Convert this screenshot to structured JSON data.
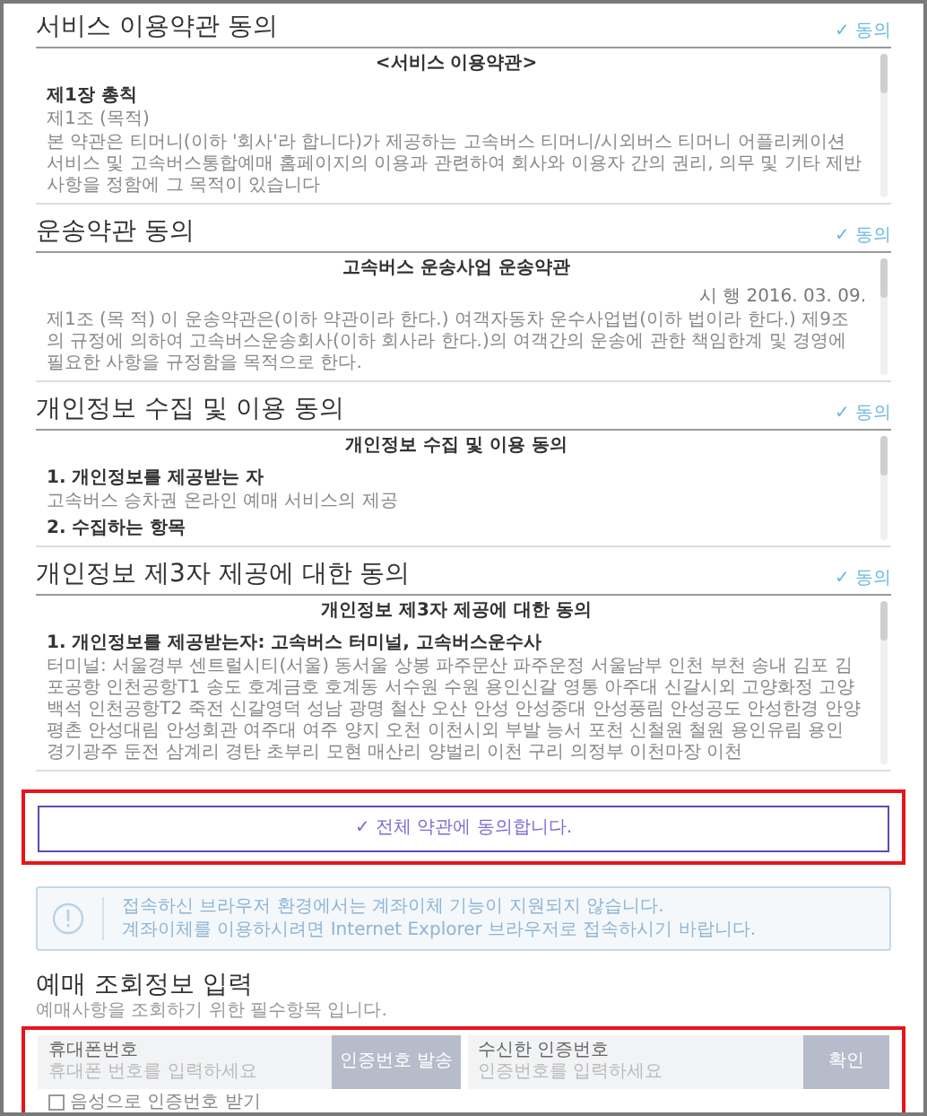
{
  "sections": [
    {
      "title": "서비스 이용약관 동의",
      "agree": "✓ 동의",
      "content": [
        {
          "kind": "heading",
          "text": "<서비스 이용약관>"
        },
        {
          "kind": "subheading",
          "text": "제1장 총칙"
        },
        {
          "kind": "text",
          "text": "제1조 (목적)"
        },
        {
          "kind": "text",
          "text": "본 약관은 티머니(이하 '회사'라 합니다)가 제공하는 고속버스 티머니/시외버스 티머니 어플리케이션 서비스 및 고속버스통합예매 홈페이지의 이용과 관련하여 회사와 이용자 간의 권리, 의무 및 기타 제반 사항을 정함에 그 목적이 있습니다"
        }
      ]
    },
    {
      "title": "운송약관 동의",
      "agree": "✓ 동의",
      "content": [
        {
          "kind": "heading",
          "text": "고속버스 운송사업 운송약관"
        },
        {
          "kind": "date",
          "text": "시 행 2016. 03. 09."
        },
        {
          "kind": "text",
          "text": "제1조 (목 적) 이 운송약관은(이하 약관이라 한다.) 여객자동차 운수사업법(이하 법이라 한다.) 제9조의 규정에 의하여 고속버스운송회사(이하 회사라 한다.)의 여객간의 운송에 관한 책임한계 및 경영에 필요한 사항을 규정함을 목적으로 한다."
        }
      ]
    },
    {
      "title": "개인정보 수집 및 이용 동의",
      "agree": "✓ 동의",
      "content": [
        {
          "kind": "heading",
          "text": "개인정보 수집 및 이용 동의"
        },
        {
          "kind": "subheading",
          "text": "1. 개인정보를 제공받는 자"
        },
        {
          "kind": "text",
          "text": "고속버스 승차권 온라인 예매 서비스의 제공"
        },
        {
          "kind": "subheading",
          "text": "2. 수집하는 항목"
        }
      ]
    },
    {
      "title": "개인정보 제3자 제공에 대한 동의",
      "agree": "✓ 동의",
      "content": [
        {
          "kind": "heading",
          "text": "개인정보 제3자 제공에 대한 동의"
        },
        {
          "kind": "subheading",
          "text": "1. 개인정보를 제공받는자: 고속버스 터미널, 고속버스운수사"
        },
        {
          "kind": "text",
          "text": "터미널: 서울경부 센트럴시티(서울) 동서울 상봉 파주문산 파주운정 서울남부 인천 부천 송내 김포 김포공항 인천공항T1 송도 호계금호 호계동 서수원 수원 용인신갈 영통 아주대 신갈시외 고양화정 고양백석 인천공항T2 죽전 신갈영덕 성남 광명 철산 오산 안성 안성중대 안성풍림 안성공도 안성한경 안양 평촌 안성대림 안성회관 여주대 여주 양지 오천 이천시외 부발 능서 포천 신철원 철원 용인유림 용인 경기광주 둔전 삼계리 경탄 초부리 모현 매산리 양벌리 이천 구리 의정부 이천마장 이천"
        }
      ]
    }
  ],
  "agree_all": "✓ 전체 약관에 동의합니다.",
  "notice": [
    "접속하신 브라우저 환경에서는 계좌이체 기능이 지원되지 않습니다.",
    "계좌이체를 이용하시려면 Internet Explorer 브라우저로 접속하시기 바랍니다."
  ],
  "booking": {
    "title": "예매 조회정보 입력",
    "subtitle": "예매사항을 조회하기 위한 필수항목 입니다.",
    "fields": [
      {
        "label": "휴대폰번호",
        "placeholder": "휴대폰 번호를 입력하세요",
        "button": "인증번호 발송"
      },
      {
        "label": "수신한 인증번호",
        "placeholder": "인증번호를 입력하세요",
        "button": "확인"
      }
    ],
    "checkbox": {
      "label": "음성으로 인증번호 받기",
      "checked": false
    }
  }
}
